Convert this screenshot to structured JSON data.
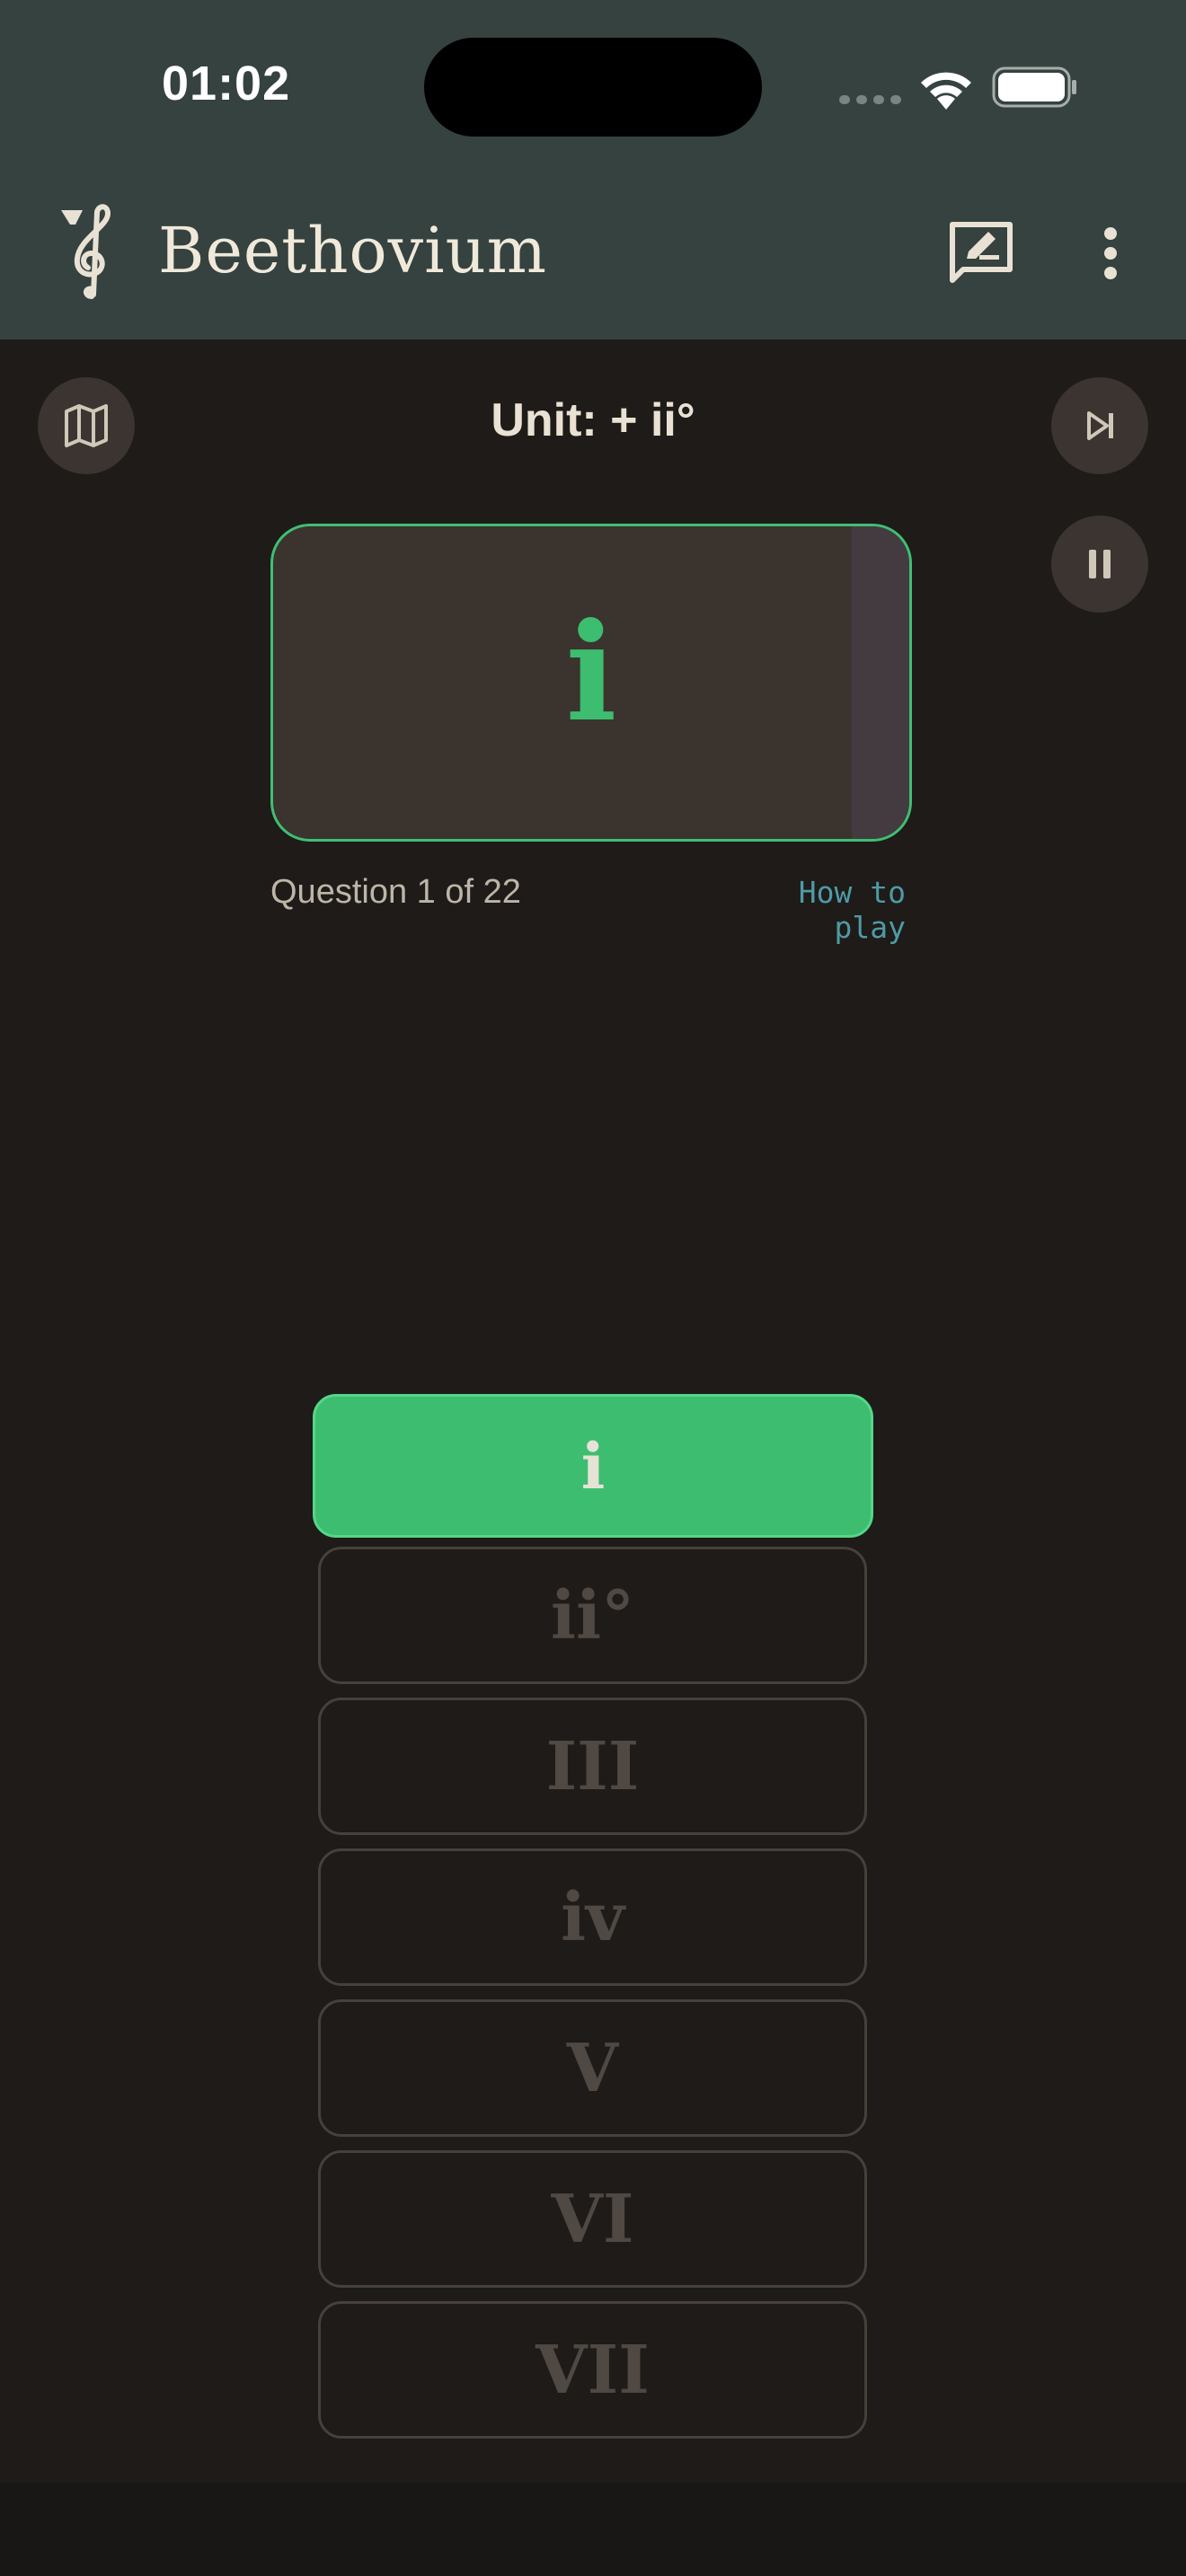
{
  "status_bar": {
    "time": "01:02"
  },
  "app_bar": {
    "title": "Beethovium",
    "logo_icon": "treble-clef-logo-icon",
    "feedback_icon": "feedback-edit-icon",
    "menu_icon": "more-vertical-icon"
  },
  "game": {
    "unit_title": "Unit: + ii°",
    "map_icon": "map-icon",
    "skip_icon": "skip-next-icon",
    "pause_icon": "pause-icon",
    "card": {
      "chord": "i"
    },
    "progress_text": "Question 1 of 22",
    "how_to_play": "How to play"
  },
  "answers": [
    {
      "label": "i",
      "selected": true
    },
    {
      "label": "ii°",
      "selected": false
    },
    {
      "label": "III",
      "selected": false
    },
    {
      "label": "iv",
      "selected": false
    },
    {
      "label": "V",
      "selected": false
    },
    {
      "label": "VI",
      "selected": false
    },
    {
      "label": "VII",
      "selected": false
    }
  ],
  "colors": {
    "app_bar_bg": "#354240",
    "background": "#1e1b18",
    "accent_green": "#3dbd70",
    "link_teal": "#4f9aa6"
  }
}
